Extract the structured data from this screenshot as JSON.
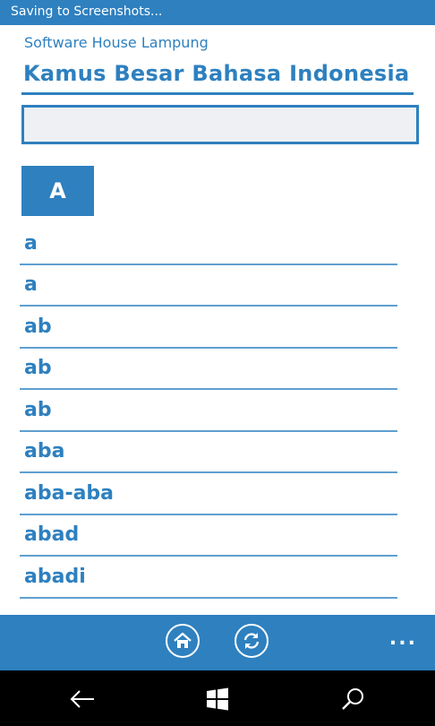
{
  "status_bar": {
    "text": "Saving to Screenshots..."
  },
  "header": {
    "subtitle": "Software House Lampung",
    "title": "Kamus Besar Bahasa Indonesia"
  },
  "search": {
    "value": "",
    "placeholder": ""
  },
  "section": {
    "letter": "A"
  },
  "words": [
    "a",
    "a",
    "ab",
    "ab",
    "ab",
    "aba",
    "aba-aba",
    "abad",
    "abadi"
  ],
  "app_bar": {
    "more_label": "..."
  },
  "colors": {
    "accent": "#2e80bf",
    "divider": "#5f9fd0",
    "input_bg": "#eef0f3"
  },
  "icons": {
    "home": "home-icon",
    "refresh": "refresh-icon",
    "back": "back-arrow-icon",
    "windows": "windows-logo-icon",
    "search": "search-icon"
  }
}
